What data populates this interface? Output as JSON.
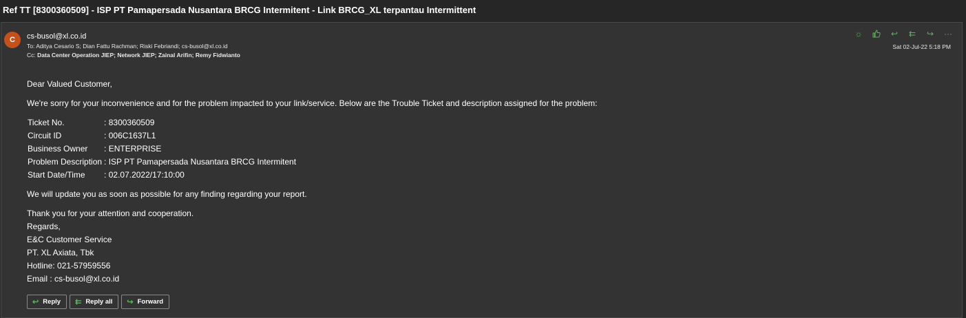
{
  "subject": "Ref TT [8300360509] - ISP PT Pamapersada Nusantara BRCG Intermitent - Link BRCG_XL terpantau Intermittent",
  "header": {
    "avatar_initial": "C",
    "sender": "cs-busol@xl.co.id",
    "to_label": "To:",
    "to": "Aditya Cesario S;  Dian Fattu Rachman;  Riski Febriandi;  cs-busol@xl.co.id",
    "cc_label": "Cc:",
    "cc": "Data Center Operation JIEP;  Network JIEP;  Zainal Arifin;  Remy Fidwianto",
    "date": "Sat 02-Jul-22 5:18 PM"
  },
  "actions": [
    {
      "name": "sun-icon",
      "glyph": "☼"
    },
    {
      "name": "like-icon",
      "glyph": "👍"
    },
    {
      "name": "reply-icon",
      "glyph": "↩"
    },
    {
      "name": "reply-all-icon",
      "glyph": "⇇"
    },
    {
      "name": "forward-icon",
      "glyph": "↪"
    },
    {
      "name": "more-icon",
      "glyph": "···"
    }
  ],
  "body": {
    "greeting": "Dear Valued Customer,",
    "intro": "We're sorry for your inconvenience and for the problem impacted to your link/service. Below are the Trouble Ticket and description assigned for the problem:",
    "ticket": [
      {
        "label": "Ticket No.",
        "value": ": 8300360509"
      },
      {
        "label": "Circuit ID",
        "value": ": 006C1637L1"
      },
      {
        "label": "Business Owner",
        "value": ": ENTERPRISE"
      },
      {
        "label": "Problem Description",
        "value": ": ISP PT Pamapersada Nusantara BRCG Intermitent"
      },
      {
        "label": "Start Date/Time",
        "value": ": 02.07.2022/17:10:00"
      }
    ],
    "update": "We will update you as soon as possible for any finding regarding your report.",
    "thanks": "Thank you for your attention and cooperation.",
    "regards": "Regards,",
    "sig1": "E&C Customer Service",
    "sig2": "PT. XL Axiata, Tbk",
    "sig3": "Hotline: 021-57959556",
    "sig4": "Email : cs-busol@xl.co.id"
  },
  "buttons": {
    "reply": "Reply",
    "reply_all": "Reply all",
    "forward": "Forward"
  },
  "colors": {
    "accent_green": "#5fb05f",
    "avatar": "#c4501a",
    "panel": "#333333",
    "background": "#262626"
  }
}
